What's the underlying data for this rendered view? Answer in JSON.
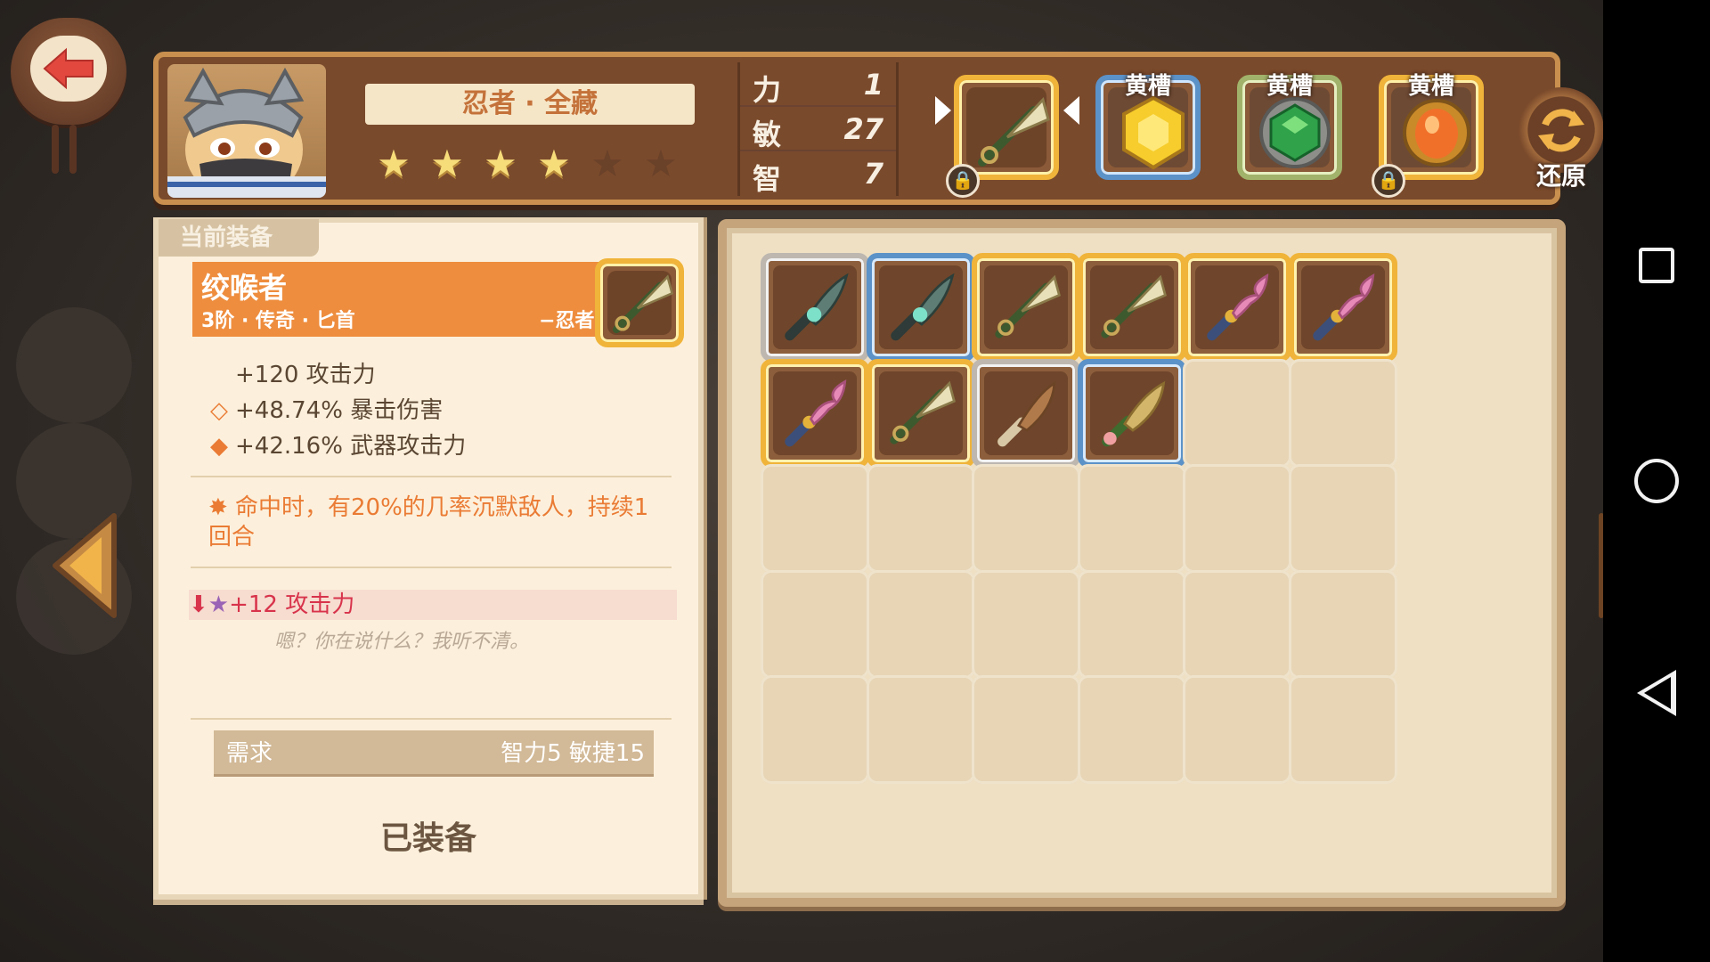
{
  "header": {
    "hero_name": "忍者 · 全藏",
    "stars_filled": 4,
    "stars_total": 6,
    "stats": [
      {
        "label": "力",
        "value": "1"
      },
      {
        "label": "敏",
        "value": "27"
      },
      {
        "label": "智",
        "value": "7"
      }
    ],
    "equip_slots": [
      {
        "label": "",
        "item": "bone-dagger-icon",
        "border": "gold",
        "locked": true,
        "selected": true
      },
      {
        "label": "黄槽",
        "item": "yellow-gem-icon",
        "border": "blue",
        "locked": false
      },
      {
        "label": "黄槽",
        "item": "green-gem-icon",
        "border": "green",
        "locked": false
      },
      {
        "label": "黄槽",
        "item": "orange-gem-icon",
        "border": "gold",
        "locked": true
      }
    ],
    "restore_label": "还原"
  },
  "detail": {
    "tab_label": "当前装备",
    "item_name": "绞喉者",
    "item_subtitle": "3阶 · 传奇 · 匕首",
    "item_class": "−忍者−",
    "stats": [
      {
        "icon": "",
        "text": "+120 攻击力"
      },
      {
        "icon": "hollow-diamond-icon",
        "text": "+48.74% 暴击伤害"
      },
      {
        "icon": "diamond-icon",
        "text": "+42.16% 武器攻击力"
      }
    ],
    "skill": "命中时，有20%的几率沉默敌人，持续1回合",
    "compare": "+12 攻击力",
    "flavor": "嗯？你在说什么？我听不清。",
    "requirement_label": "需求",
    "requirement_value": "智力5  敏捷15",
    "equipped_label": "已装备"
  },
  "inventory": [
    {
      "item": "jade-curved-dagger-icon",
      "border": "silver"
    },
    {
      "item": "jade-curved-dagger-icon",
      "border": "blue"
    },
    {
      "item": "bone-dagger-icon",
      "border": "gold"
    },
    {
      "item": "bone-dagger-icon",
      "border": "gold"
    },
    {
      "item": "pink-kris-icon",
      "border": "gold"
    },
    {
      "item": "pink-kris-icon",
      "border": "gold"
    },
    {
      "item": "pink-kris-icon",
      "border": "gold"
    },
    {
      "item": "bone-dagger-icon",
      "border": "gold"
    },
    {
      "item": "wooden-knife-icon",
      "border": "silver"
    },
    {
      "item": "leaf-dagger-icon",
      "border": "blue"
    }
  ],
  "inventory_empty_slots": 20,
  "colors": {
    "gold_border": "#f0b43a",
    "blue_border": "#5b92c8",
    "silver_border": "#bdb7b0",
    "item_header_bg": "#ee8d3e",
    "accent_orange": "#ea7b34",
    "compare_red": "#d8334b"
  }
}
